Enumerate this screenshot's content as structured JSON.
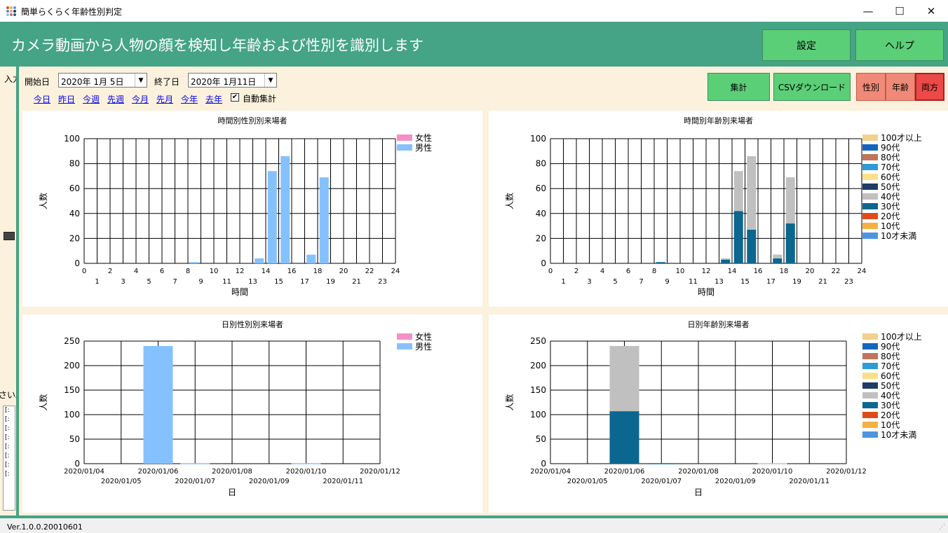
{
  "window": {
    "title": "簡単らくらく年齢性別判定",
    "minimize": "—",
    "maximize": "☐",
    "close": "✕",
    "icon": "app-grid-icon"
  },
  "header": {
    "title": "カメラ動画から人物の顔を検知し年齢および性別を識別します",
    "settings_label": "設定",
    "help_label": "ヘルプ"
  },
  "left_panel": {
    "input_label": "入力",
    "note_fragment": "さい。",
    "log_lines": [
      "[:",
      "[:",
      "[:",
      "[:",
      "[:",
      "[:",
      "[:",
      "[:"
    ]
  },
  "toolbar": {
    "start_label": "開始日",
    "start_value": "2020年  1月  5日",
    "end_label": "終了日",
    "end_value": "2020年  1月11日",
    "dropdown_icon": "▼",
    "quick_links": [
      "今日",
      "昨日",
      "今週",
      "先週",
      "今月",
      "先月",
      "今年",
      "去年"
    ],
    "auto_sum_checked": true,
    "check_mark": "✔",
    "auto_sum_label": "自動集計",
    "aggregate_label": "集計",
    "csv_label": "CSVダウンロード",
    "mode_gender": "性別",
    "mode_age": "年齢",
    "mode_both": "両方",
    "active_mode": "両方"
  },
  "legend_colors": {
    "female": "#f48fc7",
    "male": "#86c1ff",
    "age": {
      "100才以上": "#f2d08e",
      "90代": "#1565c0",
      "80代": "#c0745a",
      "70代": "#2e9ad6",
      "60代": "#fbe08a",
      "50代": "#1f3b66",
      "40代": "#c0c0c0",
      "30代": "#0b6690",
      "20代": "#e04b1a",
      "10代": "#f5b042",
      "10才未満": "#4e95e0"
    }
  },
  "chart_data": [
    {
      "type": "bar",
      "title": "時間別性別別来場者",
      "xlabel": "時間",
      "ylabel": "人数",
      "x_ticks": [
        "0",
        "1",
        "2",
        "3",
        "4",
        "5",
        "6",
        "7",
        "8",
        "9",
        "10",
        "11",
        "12",
        "13",
        "14",
        "15",
        "16",
        "17",
        "18",
        "19",
        "20",
        "21",
        "22",
        "23",
        "24"
      ],
      "xlim": [
        0,
        24
      ],
      "ylim": [
        0,
        100
      ],
      "y_ticks": [
        "0",
        "20",
        "40",
        "60",
        "80",
        "100"
      ],
      "categories": [
        8,
        13,
        14,
        15,
        17,
        18
      ],
      "legend": [
        "女性",
        "男性"
      ],
      "series": [
        {
          "name": "女性",
          "values": [
            0,
            0,
            0,
            0,
            0,
            0
          ]
        },
        {
          "name": "男性",
          "values": [
            1,
            4,
            74,
            86,
            7,
            69
          ]
        }
      ],
      "grid": true,
      "legend_position": "top-right"
    },
    {
      "type": "bar",
      "title": "時間別年齢別来場者",
      "xlabel": "時間",
      "ylabel": "人数",
      "x_ticks": [
        "0",
        "1",
        "2",
        "3",
        "4",
        "5",
        "6",
        "7",
        "8",
        "9",
        "10",
        "11",
        "12",
        "13",
        "14",
        "15",
        "16",
        "17",
        "18",
        "19",
        "20",
        "21",
        "22",
        "23",
        "24"
      ],
      "xlim": [
        0,
        24
      ],
      "ylim": [
        0,
        100
      ],
      "y_ticks": [
        "0",
        "20",
        "40",
        "60",
        "80",
        "100"
      ],
      "categories": [
        8,
        13,
        14,
        15,
        17,
        18
      ],
      "legend": [
        "100才以上",
        "90代",
        "80代",
        "70代",
        "60代",
        "50代",
        "40代",
        "30代",
        "20代",
        "10代",
        "10才未満"
      ],
      "series": [
        {
          "name": "30代",
          "values": [
            1,
            3,
            42,
            27,
            4,
            32
          ]
        },
        {
          "name": "40代",
          "values": [
            0,
            1,
            32,
            59,
            3,
            37
          ]
        }
      ],
      "grid": true,
      "legend_position": "top-right"
    },
    {
      "type": "bar",
      "title": "日別性別別来場者",
      "xlabel": "日",
      "ylabel": "人数",
      "x_ticks": [
        "2020/01/04",
        "2020/01/05",
        "2020/01/06",
        "2020/01/07",
        "2020/01/08",
        "2020/01/09",
        "2020/01/10",
        "2020/01/11",
        "2020/01/12"
      ],
      "ylim": [
        0,
        250
      ],
      "y_ticks": [
        "0",
        "50",
        "100",
        "150",
        "200",
        "250"
      ],
      "categories": [
        "2020/01/06",
        "2020/01/07",
        "2020/01/10"
      ],
      "legend": [
        "女性",
        "男性"
      ],
      "series": [
        {
          "name": "女性",
          "values": [
            0,
            0,
            0
          ]
        },
        {
          "name": "男性",
          "values": [
            240,
            1,
            1
          ]
        }
      ],
      "grid": true,
      "legend_position": "top-right"
    },
    {
      "type": "bar",
      "title": "日別年齢別来場者",
      "xlabel": "日",
      "ylabel": "人数",
      "x_ticks": [
        "2020/01/04",
        "2020/01/05",
        "2020/01/06",
        "2020/01/07",
        "2020/01/08",
        "2020/01/09",
        "2020/01/10",
        "2020/01/11",
        "2020/01/12"
      ],
      "ylim": [
        0,
        250
      ],
      "y_ticks": [
        "0",
        "50",
        "100",
        "150",
        "200",
        "250"
      ],
      "categories": [
        "2020/01/06",
        "2020/01/07",
        "2020/01/10"
      ],
      "legend": [
        "100才以上",
        "90代",
        "80代",
        "70代",
        "60代",
        "50代",
        "40代",
        "30代",
        "20代",
        "10代",
        "10才未満"
      ],
      "series": [
        {
          "name": "30代",
          "values": [
            107,
            1,
            0
          ]
        },
        {
          "name": "40代",
          "values": [
            133,
            0,
            1
          ]
        }
      ],
      "grid": true,
      "legend_position": "top-right"
    }
  ],
  "status": {
    "version": "Ver.1.0.0.20010601",
    "grip": "⋰"
  }
}
